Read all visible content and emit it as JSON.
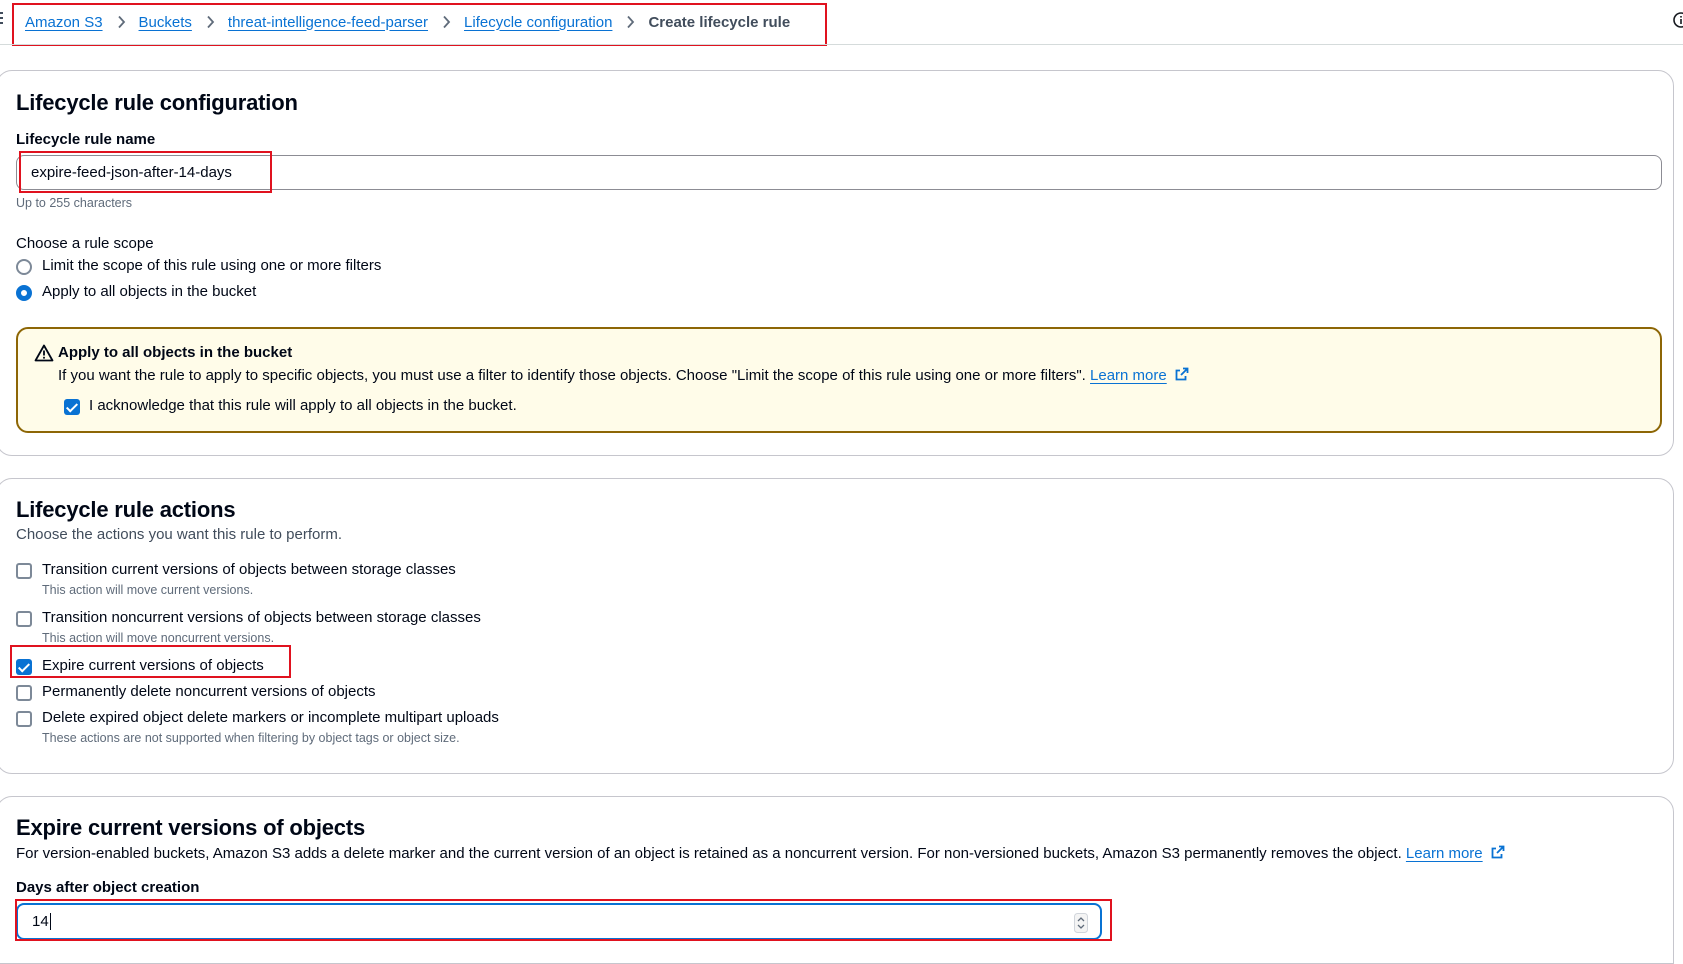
{
  "breadcrumb": {
    "items": [
      "Amazon S3",
      "Buckets",
      "threat-intelligence-feed-parser",
      "Lifecycle configuration"
    ],
    "current": "Create lifecycle rule"
  },
  "config": {
    "title": "Lifecycle rule configuration",
    "name_label": "Lifecycle rule name",
    "name_value": "expire-feed-json-after-14-days",
    "name_hint": "Up to 255 characters",
    "scope_label": "Choose a rule scope",
    "scope_options": [
      {
        "label": "Limit the scope of this rule using one or more filters",
        "selected": false
      },
      {
        "label": "Apply to all objects in the bucket",
        "selected": true
      }
    ],
    "alert": {
      "title": "Apply to all objects in the bucket",
      "text": "If you want the rule to apply to specific objects, you must use a filter to identify those objects. Choose \"Limit the scope of this rule using one or more filters\".",
      "learn_more": "Learn more",
      "ack_label": "I acknowledge that this rule will apply to all objects in the bucket.",
      "ack_checked": true
    }
  },
  "actions": {
    "title": "Lifecycle rule actions",
    "description": "Choose the actions you want this rule to perform.",
    "options": [
      {
        "label": "Transition current versions of objects between storage classes",
        "hint": "This action will move current versions.",
        "checked": false
      },
      {
        "label": "Transition noncurrent versions of objects between storage classes",
        "hint": "This action will move noncurrent versions.",
        "checked": false
      },
      {
        "label": "Expire current versions of objects",
        "checked": true
      },
      {
        "label": "Permanently delete noncurrent versions of objects",
        "checked": false
      },
      {
        "label": "Delete expired object delete markers or incomplete multipart uploads",
        "hint": "These actions are not supported when filtering by object tags or object size.",
        "checked": false
      }
    ]
  },
  "expire": {
    "title": "Expire current versions of objects",
    "description": "For version-enabled buckets, Amazon S3 adds a delete marker and the current version of an object is retained as a noncurrent version. For non-versioned buckets, Amazon S3 permanently removes the object.",
    "learn_more": "Learn more",
    "days_label": "Days after object creation",
    "days_value": "14"
  },
  "icons": {
    "breadcrumb_separator": "chevron-right-icon",
    "info": "info-icon",
    "alert": "warning-icon",
    "external": "external-link-icon",
    "spinner": "number-spinner-icon"
  },
  "colors": {
    "link": "#0972d3",
    "warning_border": "#8d6605",
    "warning_bg": "#fffce9",
    "highlight": "#e0121f"
  }
}
